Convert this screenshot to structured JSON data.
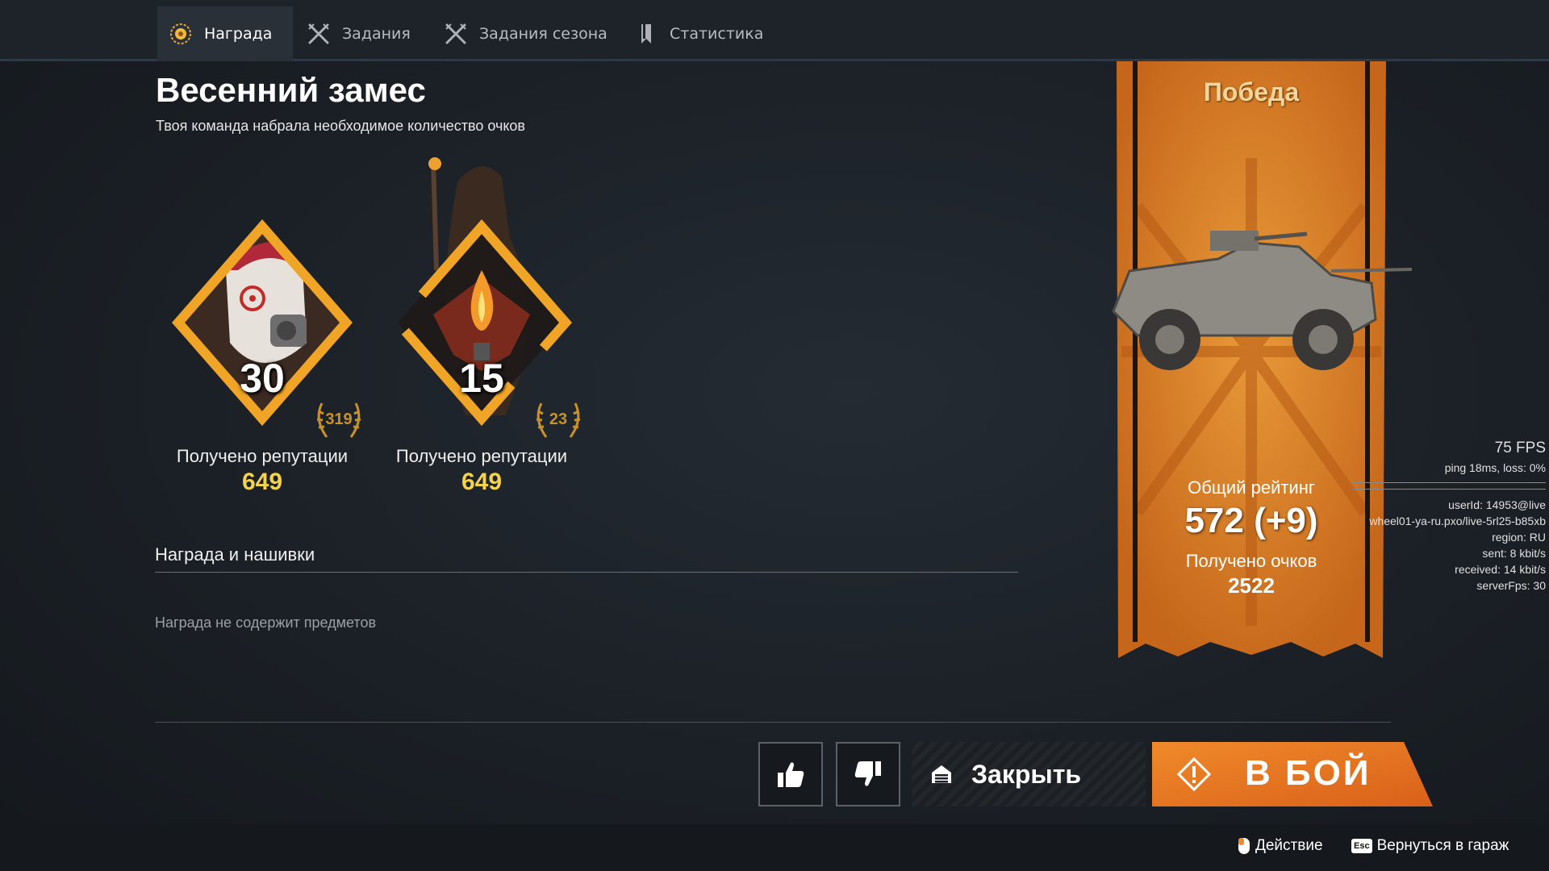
{
  "tabs": [
    {
      "label": "Награда",
      "icon": "reward-icon",
      "active": true
    },
    {
      "label": "Задания",
      "icon": "crossed-swords-icon",
      "active": false
    },
    {
      "label": "Задания сезона",
      "icon": "crossed-swords-icon",
      "active": false
    },
    {
      "label": "Статистика",
      "icon": "bookmark-icon",
      "active": false
    }
  ],
  "header": {
    "title": "Весенний замес",
    "subtitle": "Твоя команда набрала необходимое количество очков"
  },
  "reputation": [
    {
      "level": "30",
      "laurel": "319",
      "label": "Получено репутации",
      "value": "649",
      "icon": "masked-character-portrait"
    },
    {
      "level": "15",
      "laurel": "23",
      "label": "Получено репутации",
      "value": "649",
      "icon": "flame-emblem"
    }
  ],
  "rewards": {
    "title": "Награда и нашивки",
    "empty_text": "Награда не содержит предметов"
  },
  "result_banner": {
    "title": "Победа",
    "rating_label": "Общий рейтинг",
    "rating": "572 (+9)",
    "points_label": "Получено очков",
    "points": "2522",
    "icon": "armored-car-image"
  },
  "debug": {
    "fps": "75 FPS",
    "ping": "ping 18ms, loss:  0%",
    "lines": [
      "userId: 14953@live",
      "wheel01-ya-ru.pxo/live-5rl25-b85xb",
      "region: RU",
      "sent: 8 kbit/s",
      "received: 14 kbit/s",
      "serverFps: 30"
    ]
  },
  "buttons": {
    "like_icon": "thumbs-up-icon",
    "dislike_icon": "thumbs-down-icon",
    "close_label": "Закрыть",
    "fight_label": "В БОЙ"
  },
  "footer": {
    "action_label": "Действие",
    "back_label": "Вернуться в гараж",
    "esc_key": "Esc"
  },
  "colors": {
    "accent_orange": "#e8781e",
    "gold_text": "#f4d34a",
    "banner_title": "#f6d59a"
  }
}
